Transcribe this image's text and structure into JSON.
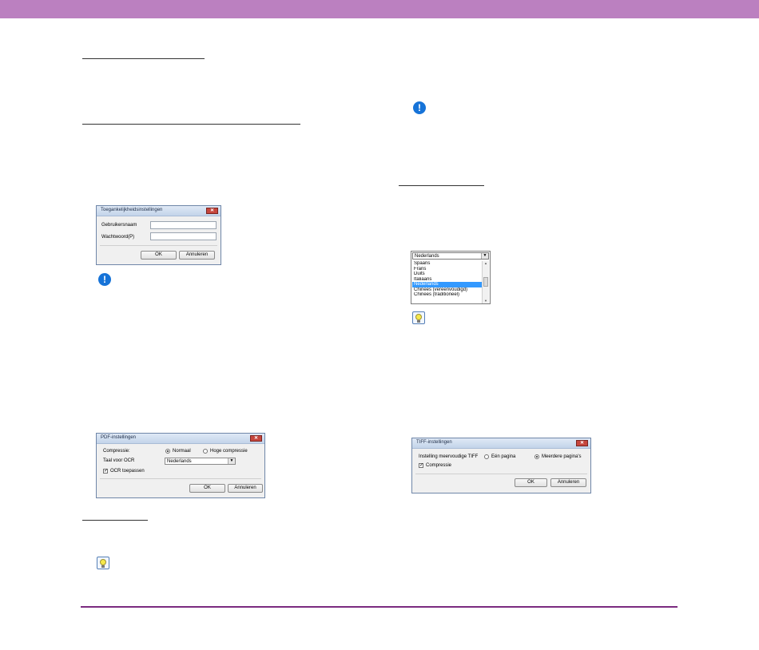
{
  "dialogs": {
    "access": {
      "title": "Toegankelijkheidsinstellingen",
      "username_label": "Gebruikersnaam",
      "password_label": "Wachtwoord(P)",
      "ok_label": "OK",
      "cancel_label": "Annuleren"
    },
    "pdf": {
      "title": "PDF-instellingen",
      "compression_label": "Compressie:",
      "option_normal": "Normaal",
      "option_high": "Hoge compressie",
      "ocr_language_label": "Taal voor OCR",
      "ocr_language_value": "Nederlands",
      "apply_ocr_label": "OCR toepassen",
      "ok_label": "OK",
      "cancel_label": "Annuleren"
    },
    "tiff": {
      "title": "TIFF-instellingen",
      "multi_label": "Instelling meervoudige TIFF",
      "option_single": "Eén pagina",
      "option_multi": "Meerdere pagina's",
      "compression_label": "Compressie",
      "ok_label": "OK",
      "cancel_label": "Annuleren"
    }
  },
  "language_dropdown": {
    "selected": "Nederlands",
    "items": [
      {
        "label": "Spaans"
      },
      {
        "label": "Frans"
      },
      {
        "label": "Duits"
      },
      {
        "label": "Italiaans"
      },
      {
        "label": "Nederlands"
      },
      {
        "label": "Chinees (vereenvoudigd)"
      },
      {
        "label": "Chinees (traditioneel)"
      }
    ],
    "highlighted_item": "Nederlands"
  },
  "colors": {
    "header_bar": "#bb80c0",
    "footer_line": "#7b2b80",
    "warning_icon": "#1673d8",
    "selection": "#3399ff"
  },
  "icons": [
    "warning-icon",
    "tip-icon"
  ]
}
